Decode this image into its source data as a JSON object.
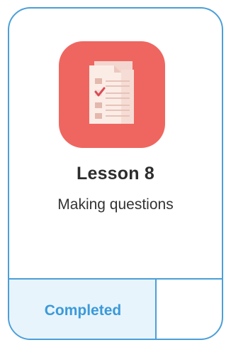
{
  "lesson": {
    "title": "Lesson 8",
    "subtitle": "Making questions",
    "icon": "checklist-document-icon",
    "status": "Completed"
  },
  "colors": {
    "border": "#4a9fd8",
    "icon_background": "#ef6660",
    "status_background": "#e8f4fc",
    "status_text": "#3b9ad9",
    "title_text": "#2d2d2d"
  }
}
